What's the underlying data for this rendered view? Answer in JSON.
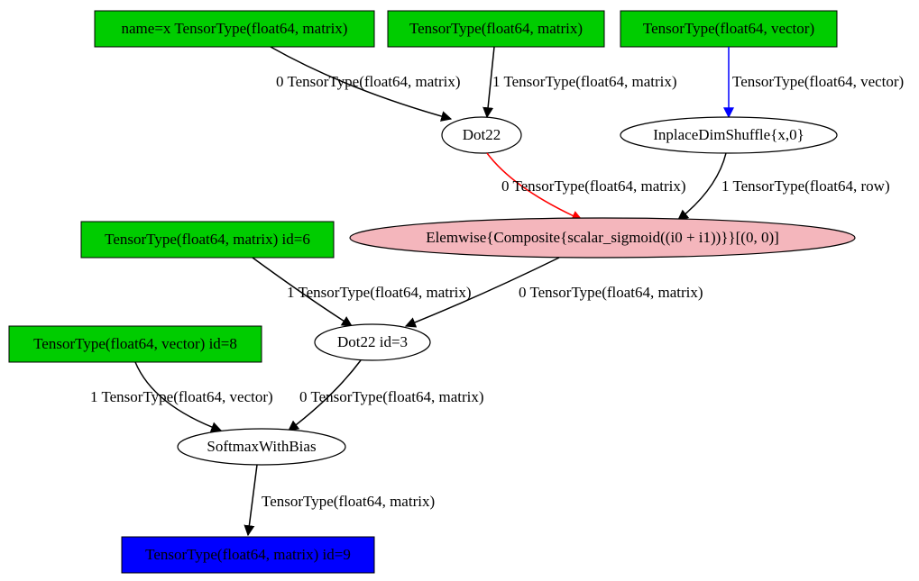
{
  "nodes": {
    "input_x": {
      "label": "name=x TensorType(float64, matrix)"
    },
    "input_w1": {
      "label": "TensorType(float64, matrix)"
    },
    "input_b1": {
      "label": "TensorType(float64, vector)"
    },
    "dot22_1": {
      "label": "Dot22"
    },
    "dimshuf": {
      "label": "InplaceDimShuffle{x,0}"
    },
    "sigmoid": {
      "label": "Elemwise{Composite{scalar_sigmoid((i0 + i1))}}[(0, 0)]"
    },
    "w2": {
      "label": "TensorType(float64, matrix) id=6"
    },
    "dot22_3": {
      "label": "Dot22 id=3"
    },
    "b2": {
      "label": "TensorType(float64, vector) id=8"
    },
    "softmax": {
      "label": "SoftmaxWithBias"
    },
    "output": {
      "label": "TensorType(float64, matrix) id=9"
    }
  },
  "edges": {
    "e_x_dot": {
      "label": "0 TensorType(float64, matrix)"
    },
    "e_w1_dot": {
      "label": "1 TensorType(float64, matrix)"
    },
    "e_b1_dim": {
      "label": "TensorType(float64, vector)"
    },
    "e_dot_sig": {
      "label": "0 TensorType(float64, matrix)"
    },
    "e_dim_sig": {
      "label": "1 TensorType(float64, row)"
    },
    "e_w2_dot3": {
      "label": "1 TensorType(float64, matrix)"
    },
    "e_sig_dot3": {
      "label": "0 TensorType(float64, matrix)"
    },
    "e_b2_soft": {
      "label": "1 TensorType(float64, vector)"
    },
    "e_dot3_soft": {
      "label": "0 TensorType(float64, matrix)"
    },
    "e_soft_out": {
      "label": "TensorType(float64, matrix)"
    }
  },
  "colors": {
    "green": "#00cc00",
    "blue": "#0000ff",
    "pink": "#f4b6bc",
    "red": "#ff0000"
  }
}
